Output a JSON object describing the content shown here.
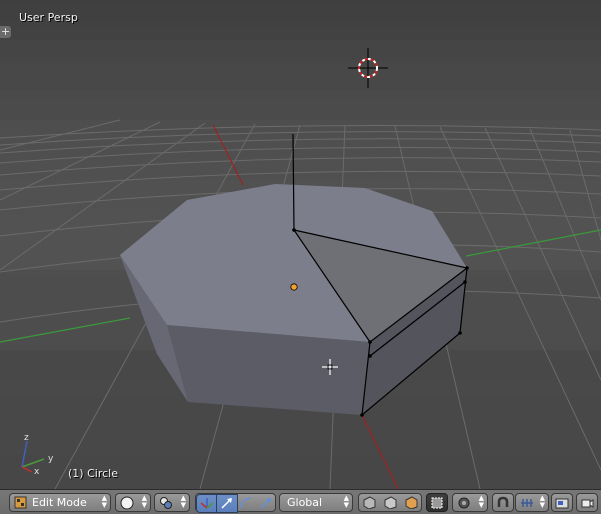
{
  "viewport": {
    "view_label": "User Persp",
    "object_label": "(1) Circle",
    "toolshelf_toggle": "+",
    "axes": {
      "x": "x",
      "y": "y",
      "z": "z"
    }
  },
  "header": {
    "editor_type_icon": "3d-view-icon",
    "mode": "Edit Mode",
    "viewport_shading_icon": "solid-sphere-icon",
    "pivot_icon": "pivot-point-icon",
    "manipulator_icons": [
      "manipulator-toggle-icon",
      "translate-arrow-icon",
      "rotate-arc-icon",
      "scale-icon"
    ],
    "transform_orientation": "Global",
    "layer_icons": [
      "vertex-select-icon",
      "edge-select-icon",
      "face-select-icon"
    ],
    "occlude_icon": "limit-selection-icon",
    "proportional_icon": "proportional-editing-icon",
    "snap_icons": [
      "magnet-icon",
      "snap-increment-icon"
    ],
    "render_icons": [
      "render-icon",
      "camera-icon"
    ]
  },
  "colors": {
    "accent": "#5a7fb8",
    "grid": "#6a6a6a",
    "x_axis": "#a02020",
    "y_axis": "#3a9a3a",
    "mesh_top": "#7d7e8c",
    "mesh_side": "#5d5e66",
    "origin_dot": "#f0a030"
  }
}
